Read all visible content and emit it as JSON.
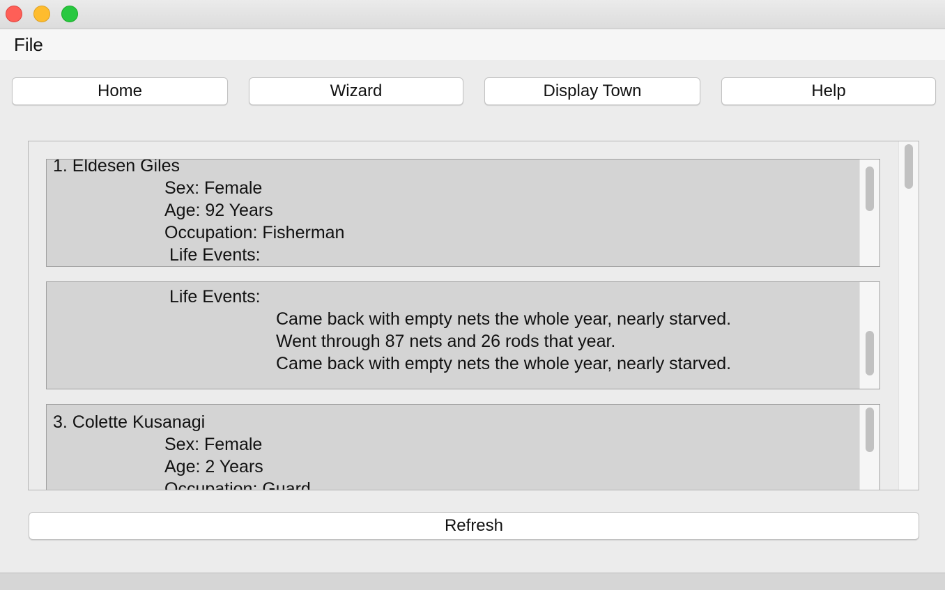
{
  "menu": {
    "file_label": "File"
  },
  "toolbar": {
    "home_label": "Home",
    "wizard_label": "Wizard",
    "display_town_label": "Display Town",
    "help_label": "Help"
  },
  "villagers": [
    {
      "name_line": "1. Eldesen Giles",
      "sex_line": "Sex: Female",
      "age_line": "Age: 92 Years",
      "occupation_line": "Occupation: Fisherman",
      "life_events_label": "Life Events:"
    },
    {
      "life_events_label": "Life Events:",
      "events": [
        "Came back with empty nets the whole year, nearly starved.",
        "Went through 87 nets and 26 rods that year.",
        "Came back with empty nets the whole year, nearly starved."
      ]
    },
    {
      "name_line": "3. Colette Kusanagi",
      "sex_line": "Sex: Female",
      "age_line": "Age: 2 Years",
      "occupation_line": "Occupation: Guard"
    }
  ],
  "footer": {
    "refresh_label": "Refresh"
  }
}
